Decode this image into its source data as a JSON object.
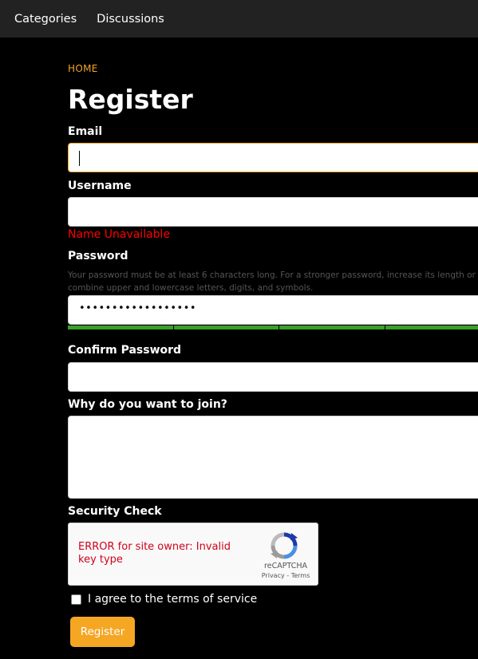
{
  "nav": {
    "items": [
      {
        "label": "Categories"
      },
      {
        "label": "Discussions"
      }
    ]
  },
  "breadcrumb": {
    "label": "HOME"
  },
  "page": {
    "title": "Register"
  },
  "form": {
    "email_label": "Email",
    "email_value": "",
    "username_label": "Username",
    "username_value": "",
    "username_error": "Name Unavailable",
    "password_label": "Password",
    "password_hint": "Your password must be at least 6 characters long. For a stronger password, increase its length or combine upper and lowercase letters, digits, and symbols.",
    "password_masked": "••••••••••••••••••",
    "password_strength": 1.0,
    "password_strength_color": "#3aa02a",
    "confirm_label": "Confirm Password",
    "confirm_value": "",
    "why_label": "Why do you want to join?",
    "why_value": "",
    "security_label": "Security Check",
    "captcha": {
      "error": "ERROR for site owner: Invalid key type",
      "brand": "reCAPTCHA",
      "links": "Privacy - Terms"
    },
    "agree_label": "I agree to the terms of service",
    "agree_checked": false,
    "submit_label": "Register"
  },
  "colors": {
    "accent": "#f5a623",
    "error": "#ff0000",
    "background": "#000000",
    "navbar": "#222222"
  }
}
